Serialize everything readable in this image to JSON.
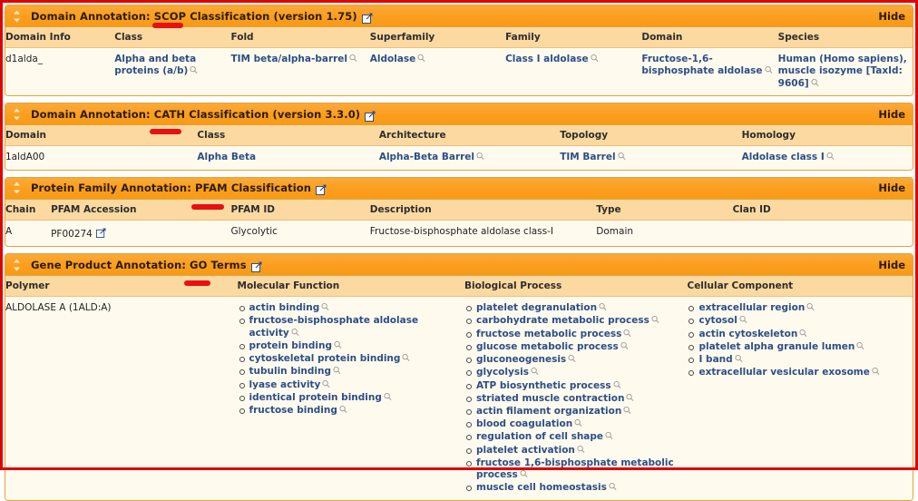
{
  "page": {
    "accent_orange": "#fb9e1f",
    "header_row_bg": "#fcd9a0",
    "body_bg": "#fffaee",
    "link_color": "#2c4f87",
    "annotation_red": "#e81010"
  },
  "panels": [
    {
      "id": "scop",
      "title_prefix": "Domain Annotation: ",
      "title_highlight": "SCOP",
      "title_suffix": " Classification (version 1.75)",
      "sort_icon": "updown-arrow-icon",
      "external_icon": "external-link-icon",
      "hide_label": "Hide",
      "columns": [
        "Domain Info",
        "Class",
        "Fold",
        "Superfamily",
        "Family",
        "Domain",
        "Species"
      ],
      "rows": [
        {
          "domain_info": "d1alda_",
          "class": "Alpha and beta proteins (a/b)",
          "fold": "TIM beta/alpha-barrel",
          "superfamily": "Aldolase",
          "family": "Class I aldolase",
          "domain": "Fructose-1,6-bisphosphate aldolase",
          "species": "Human (Homo sapiens), muscle isozyme [TaxId: 9606]"
        }
      ]
    },
    {
      "id": "cath",
      "title_prefix": "Domain Annotation: ",
      "title_highlight": "CATH",
      "title_suffix": " Classification (version 3.3.0)",
      "sort_icon": "updown-arrow-icon",
      "external_icon": "external-link-icon",
      "hide_label": "Hide",
      "columns": [
        "Domain",
        "Class",
        "Architecture",
        "Topology",
        "Homology"
      ],
      "rows": [
        {
          "domain": "1aldA00",
          "class": "Alpha Beta",
          "architecture": "Alpha-Beta Barrel",
          "topology": "TIM Barrel",
          "homology": "Aldolase class I"
        }
      ]
    },
    {
      "id": "pfam",
      "title_prefix": "Protein Family Annotation: ",
      "title_highlight": "PFAM",
      "title_suffix": " Classification",
      "sort_icon": "updown-arrow-icon",
      "external_icon": "external-link-icon",
      "hide_label": "Hide",
      "columns": [
        "Chain",
        "PFAM Accession",
        "PFAM ID",
        "Description",
        "Type",
        "Clan ID"
      ],
      "rows": [
        {
          "chain": "A",
          "accession": "PF00274",
          "pfam_id": "Glycolytic",
          "description": "Fructose-bisphosphate aldolase class-I",
          "type": "Domain",
          "clan_id": ""
        }
      ]
    },
    {
      "id": "go",
      "title_prefix": "Gene Product Annotation: ",
      "title_highlight": "GO Terms",
      "title_suffix": "",
      "sort_icon": "updown-arrow-icon",
      "external_icon": "external-link-icon",
      "hide_label": "Hide",
      "columns": [
        "Polymer",
        "Molecular Function",
        "Biological Process",
        "Cellular Component"
      ],
      "rows": [
        {
          "polymer": "ALDOLASE A (1ALD:A)",
          "molecular_function": [
            "actin binding",
            "fructose-bisphosphate aldolase activity",
            "protein binding",
            "cytoskeletal protein binding",
            "tubulin binding",
            "lyase activity",
            "identical protein binding",
            "fructose binding"
          ],
          "biological_process": [
            "platelet degranulation",
            "carbohydrate metabolic process",
            "fructose metabolic process",
            "glucose metabolic process",
            "gluconeogenesis",
            "glycolysis",
            "ATP biosynthetic process",
            "striated muscle contraction",
            "actin filament organization",
            "blood coagulation",
            "regulation of cell shape",
            "platelet activation",
            "fructose 1,6-bisphosphate metabolic process",
            "muscle cell homeostasis"
          ],
          "cellular_component": [
            "extracellular region",
            "cytosol",
            "actin cytoskeleton",
            "platelet alpha granule lumen",
            "I band",
            "extracellular vesicular exosome"
          ]
        }
      ]
    }
  ]
}
